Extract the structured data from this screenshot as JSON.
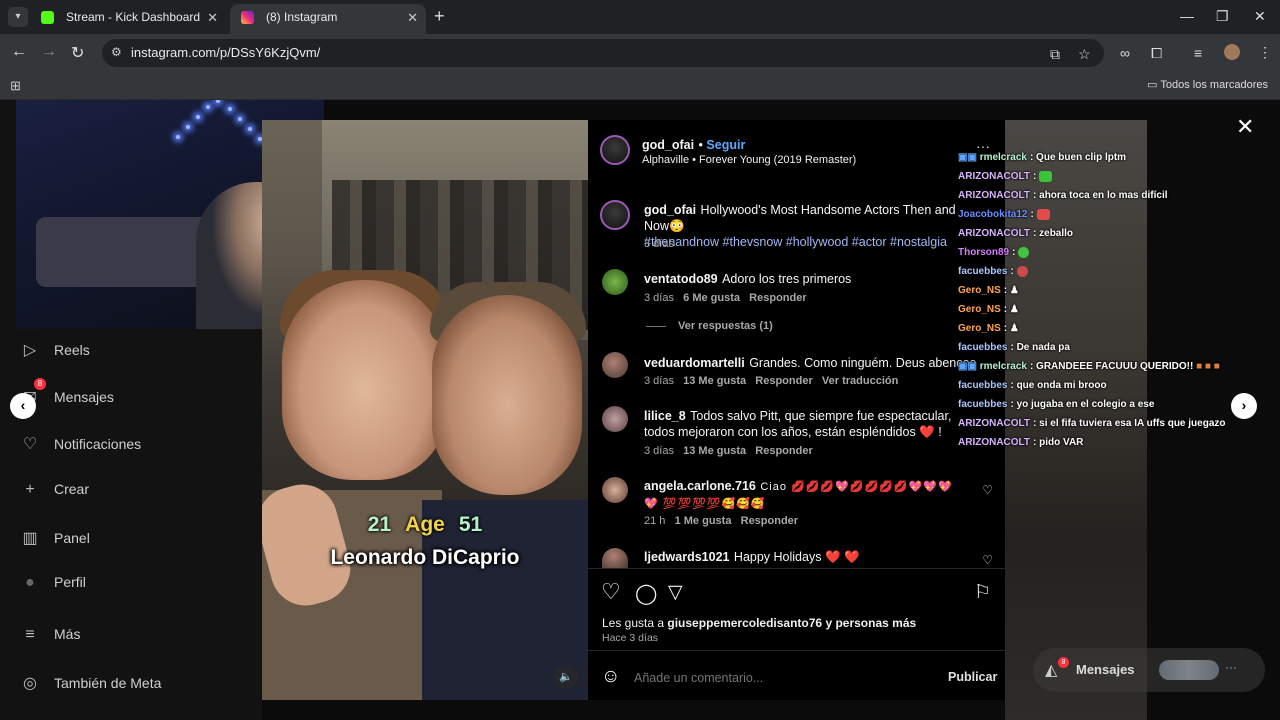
{
  "browser": {
    "tabs": [
      {
        "title": "Stream - Kick Dashboard",
        "favicon_color": "#53fc18"
      },
      {
        "title": "(8) Instagram",
        "favicon_color": "#e1306c"
      }
    ],
    "url": "instagram.com/p/DSsY6KzjQvm/",
    "bookmarks_folder": "Todos los marcadores"
  },
  "sidebar": {
    "items": [
      {
        "icon": "reels-icon",
        "glyph": "▷",
        "label": "Reels"
      },
      {
        "icon": "messages-icon",
        "glyph": "✉",
        "label": "Mensajes",
        "badge": "8"
      },
      {
        "icon": "heart-icon",
        "glyph": "♡",
        "label": "Notificaciones"
      },
      {
        "icon": "plus-icon",
        "glyph": "+",
        "label": "Crear"
      },
      {
        "icon": "dashboard-icon",
        "glyph": "▥",
        "label": "Panel"
      },
      {
        "icon": "profile-icon",
        "glyph": "●",
        "label": "Perfil"
      },
      {
        "icon": "menu-icon",
        "glyph": "≡",
        "label": "Más"
      },
      {
        "icon": "meta-icon",
        "glyph": "◎",
        "label": "También de Meta"
      }
    ]
  },
  "post": {
    "age_young": "21",
    "age_label": "Age",
    "age_old": "51",
    "actor_name": "Leonardo DiCaprio"
  },
  "header": {
    "username": "god_ofai",
    "follow": "Seguir",
    "song": "Alphaville • Forever Young (2019 Remaster)"
  },
  "caption": {
    "username": "god_ofai",
    "text": "Hollywood's Most Handsome Actors Then and Now😳",
    "hashtags": "#thenandnow #thevsnow #hollywood #actor #nostalgia",
    "time": "3 días"
  },
  "comments": [
    {
      "user": "ventatodo89",
      "text": "Adoro los tres primeros",
      "time": "3 días",
      "likes": "6 Me gusta",
      "reply": "Responder",
      "replies": "Ver respuestas (1)"
    },
    {
      "user": "veduardomartelli",
      "text": "Grandes. Como ninguém. Deus abençoe",
      "time": "3 días",
      "likes": "13 Me gusta",
      "reply": "Responder",
      "translate": "Ver traducción"
    },
    {
      "user": "lilice_8",
      "text": "Todos salvo Pitt, que siempre fue espectacular, todos mejoraron con los años, están espléndidos ❤️ !",
      "time": "3 días",
      "likes": "13 Me gusta",
      "reply": "Responder"
    },
    {
      "user": "angela.carlone.716",
      "text": "Ciao 💋💋💋💖💋💋💋💋💖💖💖💖 💯💯💯💯🥰🥰🥰",
      "time": "21 h",
      "likes": "1 Me gusta",
      "reply": "Responder"
    },
    {
      "user": "ljedwards1021",
      "text": "Happy Holidays ❤️ ❤️"
    }
  ],
  "actions": {
    "likes_prefix": "Les gusta a",
    "likes_user": "giuseppemercoledisanto76",
    "likes_suffix": "y personas más",
    "time": "Hace 3 días",
    "comment_placeholder": "Añade un comentario...",
    "publish": "Publicar"
  },
  "chat": [
    {
      "user": "rmelcrack",
      "msg": ": Que buen clip lptm",
      "color": "#b6f2d0"
    },
    {
      "user": "ARIZONACOLT",
      "msg": ":",
      "color": "#d8b4fe",
      "emote": "#39c439"
    },
    {
      "user": "ARIZONACOLT",
      "msg": ": ahora toca en lo mas difícil",
      "color": "#d8b4fe"
    },
    {
      "user": "Joacobokita12",
      "msg": ":",
      "color": "#6c8cff",
      "emote": "#e34b4b"
    },
    {
      "user": "ARIZONACOLT",
      "msg": ": zeballo",
      "color": "#d8b4fe"
    },
    {
      "user": "Thorson89",
      "msg": ":",
      "color": "#d67bff",
      "emote": "#41c441"
    },
    {
      "user": "facuebbes",
      "msg": ":",
      "color": "#a9c4ff",
      "emote": "#cc4b4b"
    },
    {
      "user": "Gero_NS",
      "msg": ":",
      "color": "#ffa64d",
      "emote": "#eeeeee"
    },
    {
      "user": "Gero_NS",
      "msg": ":",
      "color": "#ffa64d",
      "emote": "#eeeeee"
    },
    {
      "user": "Gero_NS",
      "msg": ":",
      "color": "#ffa64d",
      "emote": "#eeeeee"
    },
    {
      "user": "facuebbes",
      "msg": ": De nada pa",
      "color": "#a9c4ff"
    },
    {
      "user": "rmelcrack",
      "msg": ": GRANDEEE FACUUU QUERIDO!!",
      "color": "#b6f2d0"
    },
    {
      "user": "facuebbes",
      "msg": ": que onda mi brooo",
      "color": "#a9c4ff"
    },
    {
      "user": "facuebbes",
      "msg": ": yo jugaba en el colegio a ese",
      "color": "#a9c4ff"
    },
    {
      "user": "ARIZONACOLT",
      "msg": ": si el fifa tuviera esa IA uffs que juegazo",
      "color": "#d8b4fe"
    },
    {
      "user": "ARIZONACOLT",
      "msg": ": pido VAR",
      "color": "#d8b4fe"
    }
  ],
  "messages_pill": {
    "label": "Mensajes",
    "badge": "8"
  }
}
